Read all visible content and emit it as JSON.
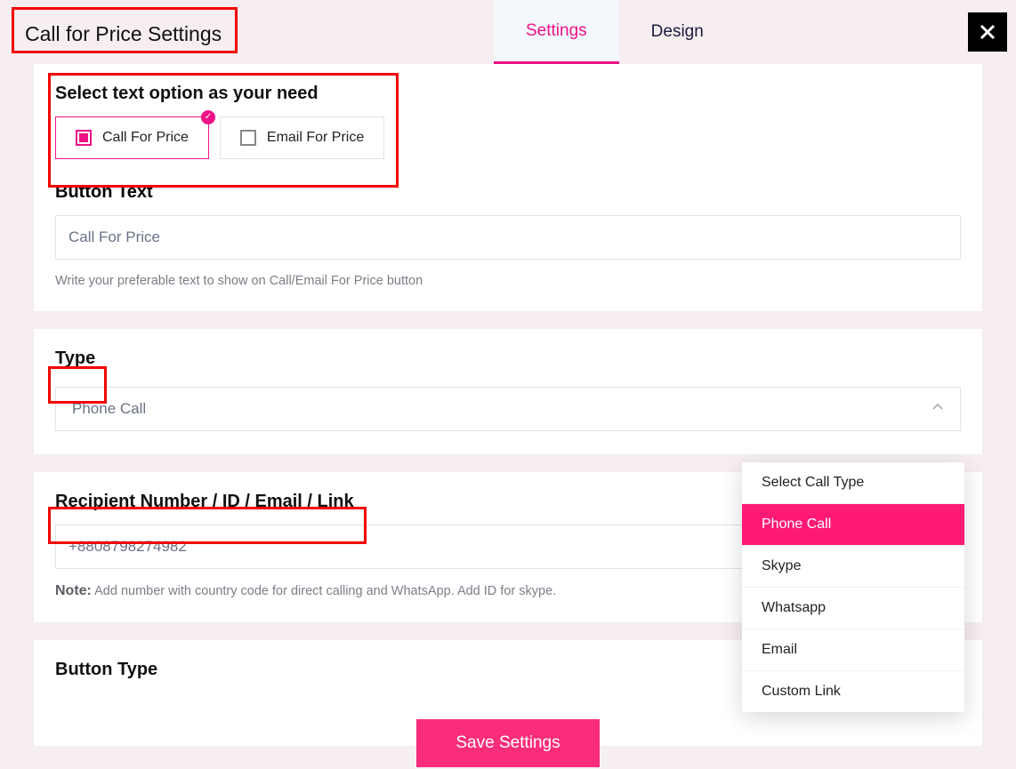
{
  "header": {
    "title": "Call for Price Settings",
    "tabs": [
      {
        "label": "Settings",
        "active": true
      },
      {
        "label": "Design",
        "active": false
      }
    ]
  },
  "text_option": {
    "heading": "Select text option as your need",
    "options": [
      {
        "label": "Call For Price",
        "selected": true
      },
      {
        "label": "Email For Price",
        "selected": false
      }
    ]
  },
  "button_text": {
    "label": "Button Text",
    "value": "Call For Price",
    "help": "Write your preferable text to show on Call/Email For Price button"
  },
  "type": {
    "label": "Type",
    "selected": "Phone Call",
    "options": [
      "Select Call Type",
      "Phone Call",
      "Skype",
      "Whatsapp",
      "Email",
      "Custom Link"
    ],
    "highlight_index": 1
  },
  "recipient": {
    "label": "Recipient Number / ID / Email / Link",
    "value": "+8808798274982",
    "note_label": "Note:",
    "note_text": "Add number with country code for direct calling and WhatsApp. Add ID for skype."
  },
  "button_type": {
    "label": "Button Type"
  },
  "save": {
    "label": "Save Settings"
  }
}
